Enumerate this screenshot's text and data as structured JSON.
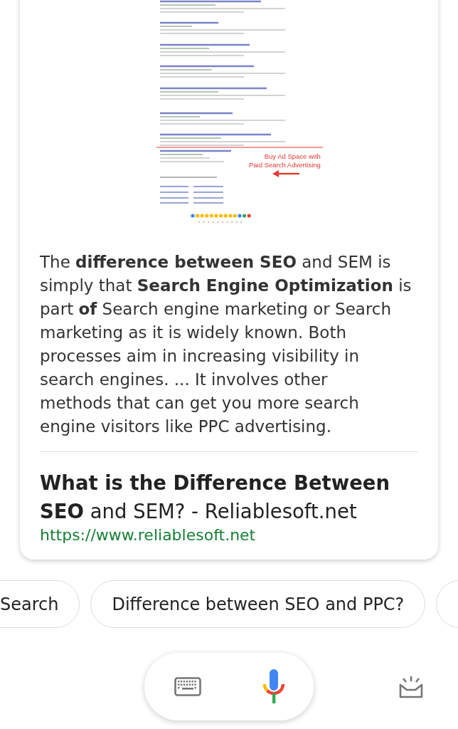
{
  "featured_image": {
    "annotation": [
      "Buy Ad Space with",
      "Paid Search Advertising"
    ]
  },
  "snippet": {
    "lines": [
      "The **difference between SEO** and SEM is",
      "simply that **Search Engine Optimization** is",
      "part **of** Search engine marketing or Search",
      "marketing as it is widely known. Both",
      "processes aim in increasing visibility in",
      "search engines. ... It involves other",
      "methods that can get you more search",
      "engine visitors like PPC advertising."
    ]
  },
  "source": {
    "title": "**What is the Difference Between SEO** and SEM? - Reliablesoft.net",
    "url": "https://www.reliablesoft.net"
  },
  "suggestion_bar": {
    "chips": [
      {
        "label": "Search"
      },
      {
        "label": "Difference between SEO and PPC?"
      }
    ],
    "more_cut_off": true
  }
}
